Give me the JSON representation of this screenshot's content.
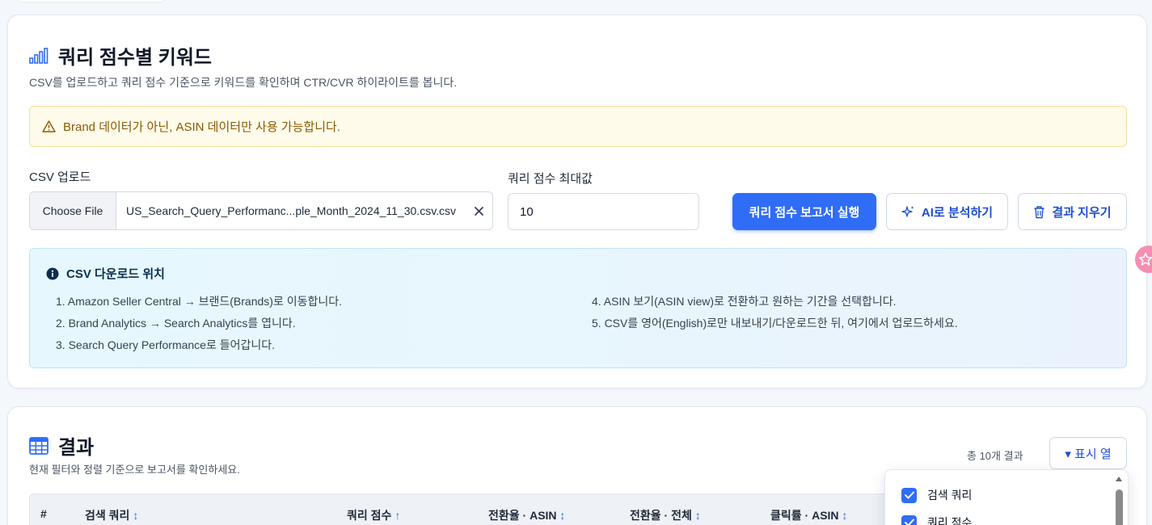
{
  "report": {
    "title": "쿼리 점수별 키워드",
    "subtitle": "CSV를 업로드하고 쿼리 점수 기준으로 키워드를 확인하며 CTR/CVR 하이라이트를 봅니다.",
    "warning": "Brand 데이터가 아닌, ASIN 데이터만 사용 가능합니다.",
    "csv_label": "CSV 업로드",
    "choose_file_label": "Choose File",
    "file_name": "US_Search_Query_Performanc...ple_Month_2024_11_30.csv.csv",
    "max_score_label": "쿼리 점수 최대값",
    "max_score_value": "10",
    "run_button": "쿼리 점수 보고서 실행",
    "ai_button": "AI로 분석하기",
    "clear_button": "결과 지우기"
  },
  "info": {
    "title": "CSV 다운로드 위치",
    "steps_left": [
      "1. Amazon Seller Central → 브랜드(Brands)로 이동합니다.",
      "2. Brand Analytics → Search Analytics를 엽니다.",
      "3. Search Query Performance로 들어갑니다."
    ],
    "steps_right": [
      "4. ASIN 보기(ASIN view)로 전환하고 원하는 기간을 선택합니다.",
      "5. CSV를 영어(English)로만 내보내기/다운로드한 뒤, 여기에서 업로드하세요."
    ]
  },
  "results": {
    "title": "결과",
    "subtitle": "현재 필터와 정렬 기준으로 보고서를 확인하세요.",
    "count": "총 10개 결과",
    "columns_button": "▾ 표시 열",
    "headers": [
      {
        "label": "#",
        "sort": ""
      },
      {
        "label": "검색 쿼리",
        "sort": "↕"
      },
      {
        "label": "쿼리 점수",
        "sort": "↑"
      },
      {
        "label": "전환율 · ASIN",
        "sort": "↕"
      },
      {
        "label": "전환율 · 전체",
        "sort": "↕"
      },
      {
        "label": "클릭률 · ASIN",
        "sort": "↕"
      }
    ]
  },
  "column_menu": {
    "items": [
      "검색 쿼리",
      "쿼리 점수"
    ]
  },
  "colors": {
    "primary": "#2f6df6",
    "warning_bg": "#fffbea",
    "warning_text": "#8a5a00",
    "info_bg": "#e6f8fd"
  }
}
